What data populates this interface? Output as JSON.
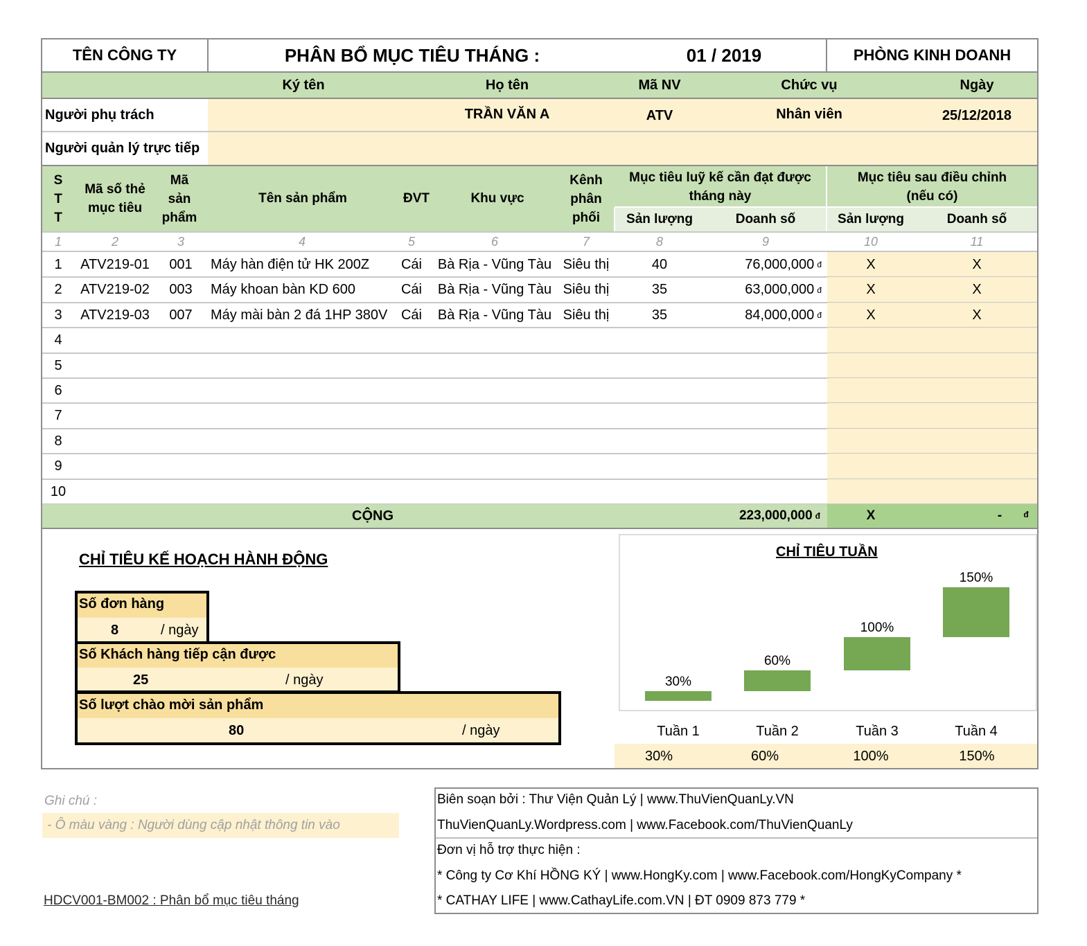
{
  "header": {
    "company": "TÊN CÔNG TY",
    "title": "PHÂN BỔ MỤC TIÊU THÁNG :",
    "month": "01 / 2019",
    "department": "PHÒNG KINH DOANH"
  },
  "signature": {
    "col_sign": "Ký tên",
    "col_name": "Họ tên",
    "col_id": "Mã NV",
    "col_position": "Chức vụ",
    "col_date": "Ngày",
    "row1_label": "Người phụ trách",
    "row1_name": "TRẦN VĂN A",
    "row1_id": "ATV",
    "row1_position": "Nhân viên",
    "row1_date": "25/12/2018",
    "row2_label": "Người quản lý trực tiếp"
  },
  "table": {
    "h_stt": "S\nT\nT",
    "h_code": "Mã số thẻ\nmục tiêu",
    "h_product_code": "Mã\nsản\nphẩm",
    "h_product_name": "Tên sản phẩm",
    "h_unit": "ĐVT",
    "h_region": "Khu vực",
    "h_channel": "Kênh\nphân\nphối",
    "h_target": "Mục tiêu luỹ kế cần đạt được\ntháng này",
    "h_adjusted": "Mục tiêu sau điều chỉnh\n(nếu có)",
    "h_qty": "Sản lượng",
    "h_revenue": "Doanh số",
    "h_qty2": "Sản lượng",
    "h_revenue2": "Doanh số",
    "col_numbers": [
      "1",
      "2",
      "3",
      "4",
      "5",
      "6",
      "7",
      "8",
      "9",
      "10",
      "11"
    ],
    "currency": "đ",
    "rows": [
      {
        "stt": "1",
        "code": "ATV219-01",
        "pcode": "001",
        "name": "Máy hàn điện tử HK 200Z",
        "unit": "Cái",
        "region": "Bà Rịa - Vũng Tàu",
        "channel": "Siêu thị",
        "qty": "40",
        "revenue": "76,000,000",
        "qty2": "X",
        "revenue2": "X"
      },
      {
        "stt": "2",
        "code": "ATV219-02",
        "pcode": "003",
        "name": "Máy khoan bàn KD 600",
        "unit": "Cái",
        "region": "Bà Rịa - Vũng Tàu",
        "channel": "Siêu thị",
        "qty": "35",
        "revenue": "63,000,000",
        "qty2": "X",
        "revenue2": "X"
      },
      {
        "stt": "3",
        "code": "ATV219-03",
        "pcode": "007",
        "name": "Máy mài bàn 2 đá 1HP 380V",
        "unit": "Cái",
        "region": "Bà Rịa - Vũng Tàu",
        "channel": "Siêu thị",
        "qty": "35",
        "revenue": "84,000,000",
        "qty2": "X",
        "revenue2": "X"
      },
      {
        "stt": "4"
      },
      {
        "stt": "5"
      },
      {
        "stt": "6"
      },
      {
        "stt": "7"
      },
      {
        "stt": "8"
      },
      {
        "stt": "9"
      },
      {
        "stt": "10"
      }
    ],
    "total_label": "CỘNG",
    "total_revenue": "223,000,000",
    "total_qty2": "X",
    "total_revenue2": "-"
  },
  "action_plan": {
    "title": "CHỈ TIÊU KẾ HOẠCH HÀNH ĐỘNG",
    "per_day": "/ ngày",
    "orders_label": "Số đơn hàng",
    "orders_value": "8",
    "customers_label": "Số Khách hàng tiếp cận được",
    "customers_value": "25",
    "offers_label": "Số lượt chào mời sản phẩm",
    "offers_value": "80"
  },
  "chart_data": {
    "type": "bar",
    "title": "CHỈ TIÊU TUẦN",
    "categories": [
      "Tuần 1",
      "Tuần 2",
      "Tuần 3",
      "Tuần 4"
    ],
    "values": [
      30,
      60,
      100,
      150
    ],
    "value_labels": [
      "30%",
      "60%",
      "100%",
      "150%"
    ],
    "unit": "%",
    "bar_color": "#76a753",
    "table_values": [
      "30%",
      "60%",
      "100%",
      "150%"
    ]
  },
  "notes": {
    "label": "Ghi chú :",
    "yellow_note": "- Ô màu vàng : Người dùng cập nhật thông tin vào",
    "form_code": "HDCV001-BM002 : Phân bổ mục tiêu tháng"
  },
  "credits": {
    "line1": "Biên soạn bởi : Thư Viện Quản Lý | www.ThuVienQuanLy.VN",
    "line2": "ThuVienQuanLy.Wordpress.com | www.Facebook.com/ThuVienQuanLy",
    "line3": "Đơn vị hỗ trợ thực hiện :",
    "line4": "* Công ty Cơ Khí HỒNG KÝ | www.HongKy.com | www.Facebook.com/HongKyCompany *",
    "line5": "* CATHAY LIFE | www.CathayLife.com.VN | ĐT 0909 873 779 *"
  },
  "colors": {
    "green": "#c6dfb4",
    "yellow": "#fdf1cf",
    "gold": "#f9df9d",
    "bar": "#76a753"
  }
}
